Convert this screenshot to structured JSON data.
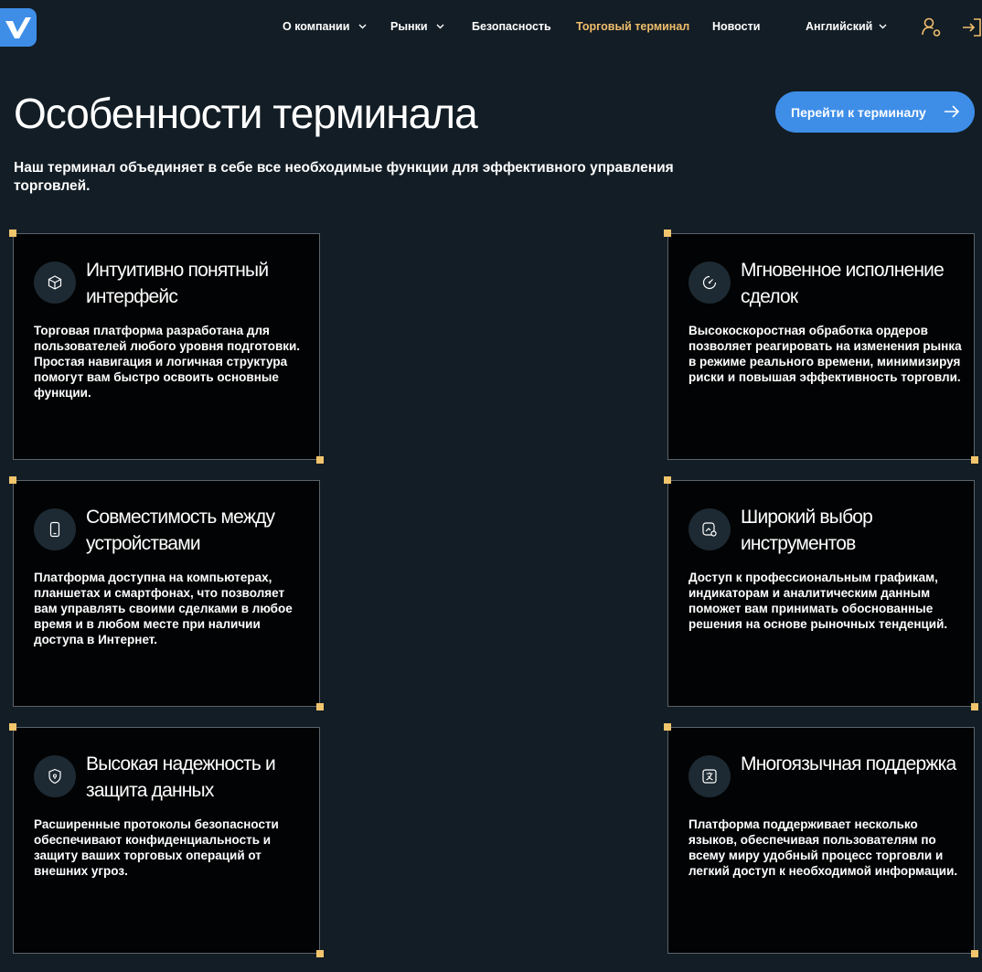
{
  "nav": {
    "items": [
      {
        "label": "О компании",
        "dropdown": true,
        "active": false
      },
      {
        "label": "Рынки",
        "dropdown": true,
        "active": false
      },
      {
        "label": "Безопасность",
        "dropdown": false,
        "active": false
      },
      {
        "label": "Торговый терминал",
        "dropdown": false,
        "active": true
      },
      {
        "label": "Новости",
        "dropdown": false,
        "active": false
      }
    ],
    "language": "Английский",
    "icons": [
      "user-settings-icon",
      "login-arrow-icon"
    ]
  },
  "page": {
    "title": "Особенности терминала",
    "subtitle": "Наш терминал объединяет в себе все необходимые функции для эффективного управления торговлей.",
    "cta_label": "Перейти к терминалу"
  },
  "colors": {
    "background": "#131d25",
    "accent": "#3e8ee8",
    "active_nav": "#f0be6c",
    "card_bg": "#020304",
    "handle": "#f2c56d"
  },
  "cards": [
    {
      "icon": "cube-icon",
      "title": "Интуитивно понятный интерфейс",
      "text": "Торговая платформа разработана для пользователей любого уровня подготовки. Простая навигация и логичная структура помогут вам быстро освоить основные функции."
    },
    {
      "icon": "speed-gauge-icon",
      "title": "Мгновенное исполнение сделок",
      "text": "Высокоскоростная обработка ордеров позволяет реагировать на изменения рынка в режиме реального времени, минимизируя риски и повышая эффективность торговли."
    },
    {
      "icon": "mobile-device-icon",
      "title": "Совместимость между устройствами",
      "text": "Платформа доступна на компьютерах, планшетах и смартфонах, что позволяет вам управлять своими сделками в любое время и в любом месте при наличии доступа в Интернет."
    },
    {
      "icon": "chart-tools-icon",
      "title": "Широкий выбор инструментов",
      "text": "Доступ к профессиональным графикам, индикаторам и аналитическим данным поможет вам принимать обоснованные решения на основе рыночных тенденций."
    },
    {
      "icon": "shield-icon",
      "title": "Высокая надежность и защита данных",
      "text": "Расширенные протоколы безопасности обеспечивают конфиденциальность и защиту ваших торговых операций от внешних угроз."
    },
    {
      "icon": "translate-icon",
      "title": "Многоязычная поддержка",
      "text": "Платформа поддерживает несколько языков, обеспечивая пользователям по всему миру удобный процесс торговли и легкий доступ к необходимой информации."
    }
  ]
}
